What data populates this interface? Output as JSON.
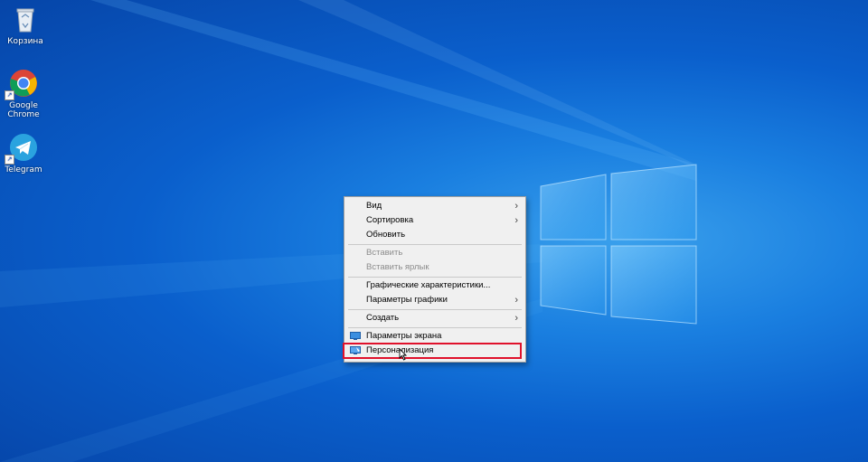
{
  "desktop": {
    "icons": [
      {
        "label": "Корзина",
        "icon": "recycle-bin-icon"
      },
      {
        "label": "Google Chrome",
        "icon": "chrome-icon"
      },
      {
        "label": "Telegram",
        "icon": "telegram-icon"
      }
    ]
  },
  "context_menu": {
    "items": [
      {
        "label": "Вид",
        "submenu": true,
        "enabled": true
      },
      {
        "label": "Сортировка",
        "submenu": true,
        "enabled": true
      },
      {
        "label": "Обновить",
        "submenu": false,
        "enabled": true
      },
      {
        "label": "Вставить",
        "submenu": false,
        "enabled": false
      },
      {
        "label": "Вставить ярлык",
        "submenu": false,
        "enabled": false
      },
      {
        "label": "Графические характеристики...",
        "submenu": false,
        "enabled": true
      },
      {
        "label": "Параметры графики",
        "submenu": true,
        "enabled": true
      },
      {
        "label": "Создать",
        "submenu": true,
        "enabled": true
      },
      {
        "label": "Параметры экрана",
        "submenu": false,
        "enabled": true,
        "icon": "display-settings-icon"
      },
      {
        "label": "Персонализация",
        "submenu": false,
        "enabled": true,
        "icon": "personalization-icon",
        "highlighted": true
      }
    ]
  },
  "colors": {
    "highlight_border": "#e0112b",
    "menu_background": "#f0f0f0",
    "desktop_accent": "#1a7fe0"
  }
}
